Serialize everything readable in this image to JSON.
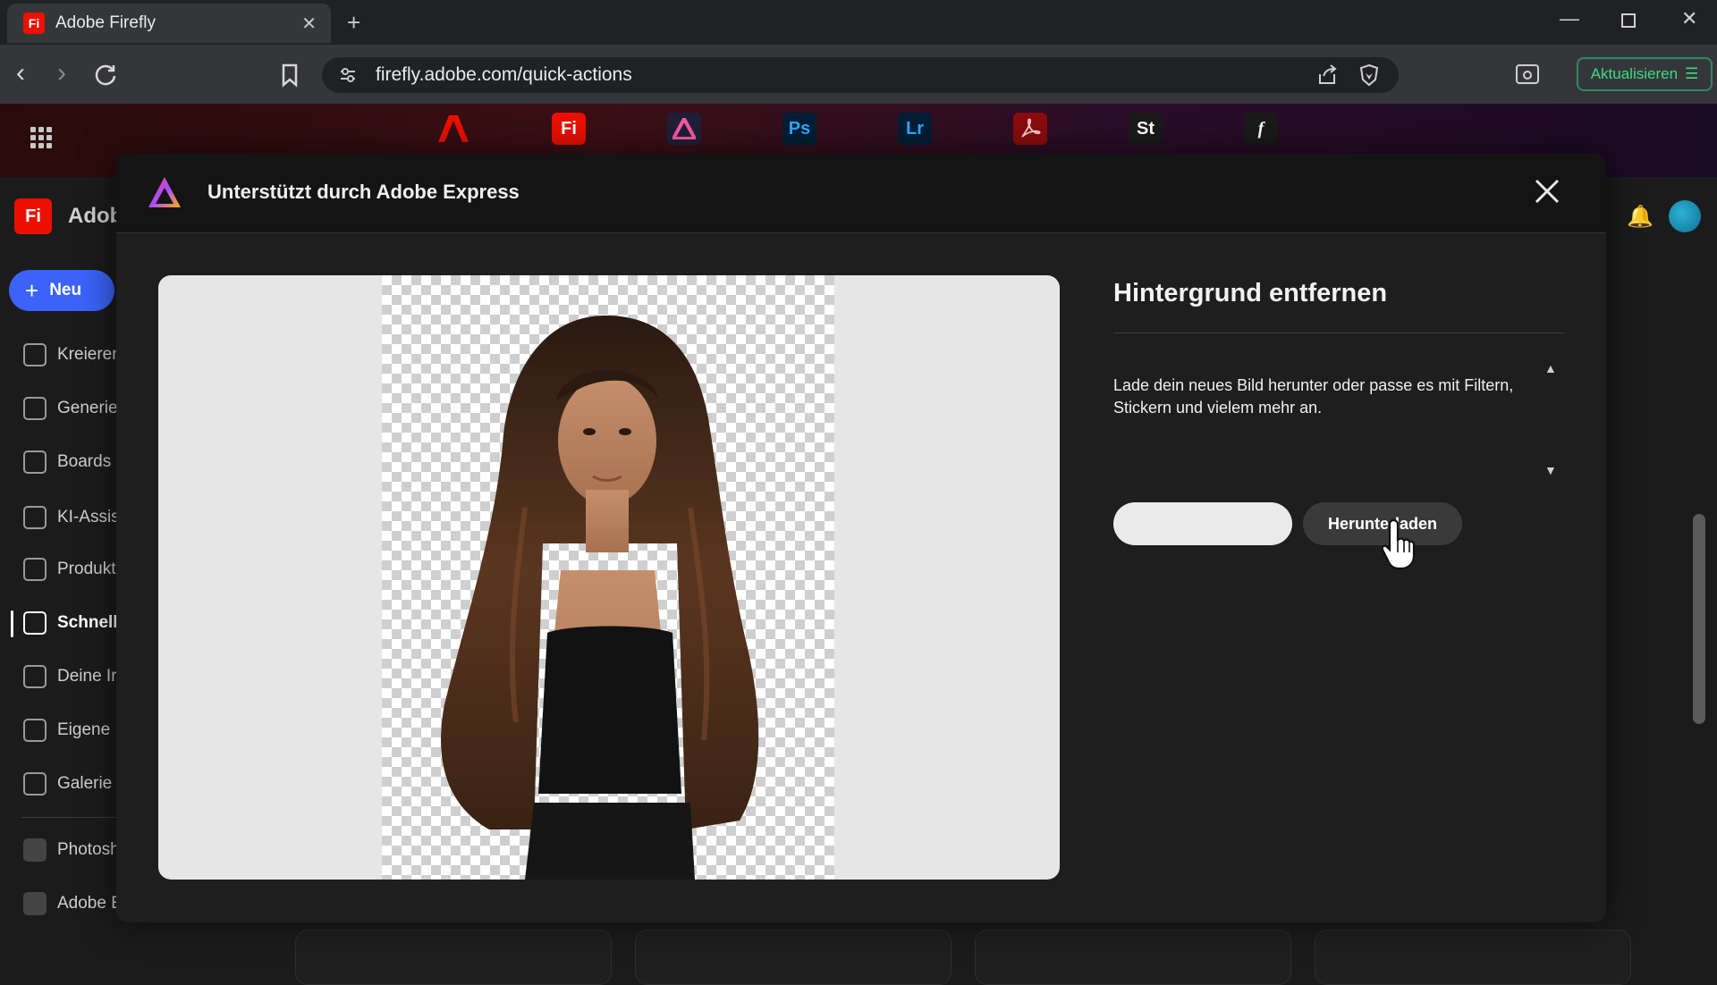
{
  "browser": {
    "tab_title": "Adobe Firefly",
    "tab_favicon": "Fi",
    "url": "firefly.adobe.com/quick-actions",
    "update_label": "Aktualisieren"
  },
  "app_switcher": {
    "items": [
      {
        "name": "acrobat-logo",
        "label": "",
        "color": "#eb1000"
      },
      {
        "name": "firefly",
        "label": "Fi",
        "color": "#eb1000"
      },
      {
        "name": "express",
        "label": "",
        "color": "#1f1f3a"
      },
      {
        "name": "photoshop",
        "label": "Ps",
        "color": "#001e36"
      },
      {
        "name": "lightroom",
        "label": "Lr",
        "color": "#001e36"
      },
      {
        "name": "acrobat",
        "label": "",
        "color": "#8b0c0c"
      },
      {
        "name": "stock",
        "label": "St",
        "color": "#1a1a1a"
      },
      {
        "name": "fonts",
        "label": "f",
        "color": "#1a1a1a"
      }
    ]
  },
  "app": {
    "brand_short": "Adob",
    "new_button": "Neu",
    "sidebar": [
      {
        "label": "Kreieren"
      },
      {
        "label": "Generie"
      },
      {
        "label": "Boards"
      },
      {
        "label": "KI-Assis"
      },
      {
        "label": "Produkt"
      },
      {
        "label": "Schnell"
      },
      {
        "label": "Deine Ir"
      },
      {
        "label": "Eigene I"
      },
      {
        "label": "Galerie"
      },
      {
        "label": "Photosh"
      },
      {
        "label": "Adobe E"
      }
    ]
  },
  "modal": {
    "header_title": "Unterstützt durch Adobe Express",
    "panel_title": "Hintergrund entfernen",
    "panel_text": "Lade dein neues Bild herunter oder passe es mit Filtern, Stickern und vielem mehr an.",
    "download_label": "Herunterladen"
  },
  "colors": {
    "accent_blue": "#3b63fb",
    "firefly_red": "#eb1000",
    "update_green": "#3ddc84"
  }
}
